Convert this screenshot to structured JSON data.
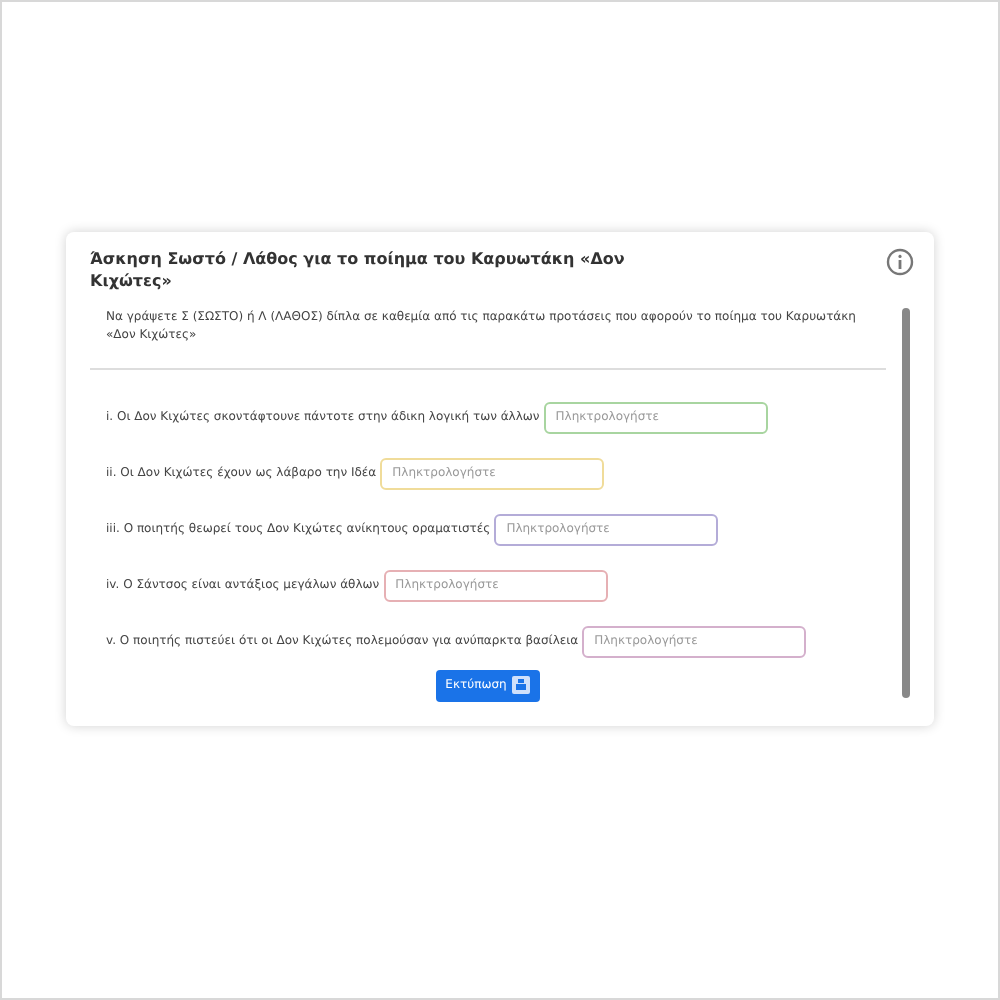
{
  "card": {
    "title": "Άσκηση Σωστό / Λάθος για το ποίημα του Καρυωτάκη «Δον Κιχώτες»",
    "instruction": "Να γράψετε Σ (ΣΩΣΤΟ) ή Λ (ΛΑΘΟΣ) δίπλα σε καθεμία από τις παρακάτω προτάσεις που αφορούν το ποίημα του Καρυωτάκη «Δον Κιχώτες»"
  },
  "questions": [
    {
      "text": "i. Οι Δον Κιχώτες σκοντάφτουνε πάντοτε στην άδικη λογική των άλλων",
      "placeholder": "Πληκτρολογήστε",
      "color": "#a8d5a0"
    },
    {
      "text": "ii. Οι Δον Κιχώτες έχουν ως λάβαρο την Ιδέα",
      "placeholder": "Πληκτρολογήστε",
      "color": "#f0dc9a"
    },
    {
      "text": "iii. Ο ποιητής θεωρεί τους Δον Κιχώτες ανίκητους οραματιστές",
      "placeholder": "Πληκτρολογήστε",
      "color": "#b4acd8"
    },
    {
      "text": "iv. Ο Σάντσος είναι αντάξιος μεγάλων άθλων",
      "placeholder": "Πληκτρολογήστε",
      "color": "#e6b0b4"
    },
    {
      "text": "v. Ο ποιητής πιστεύει ότι οι Δον Κιχώτες πολεμούσαν για ανύπαρκτα βασίλεια",
      "placeholder": "Πληκτρολογήστε",
      "color": "#d4b0cc"
    }
  ],
  "print_button": {
    "label": "Εκτύπωση"
  }
}
